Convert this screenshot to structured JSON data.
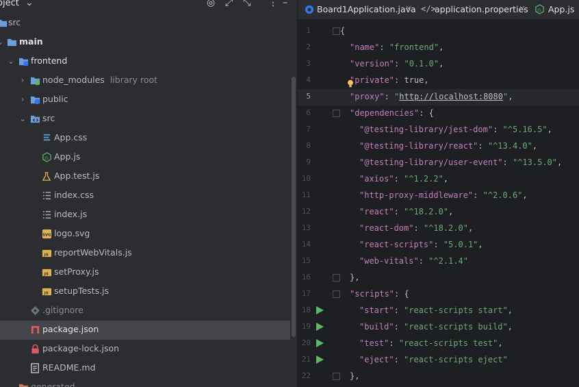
{
  "project_panel": {
    "title": "oject",
    "header_icons": [
      "chevron-down-icon",
      "locate-icon",
      "expand-all-icon",
      "collapse-all-icon",
      "more-options-icon",
      "hide-panel-icon"
    ],
    "tree": [
      {
        "label": "src",
        "icon": "folder-icon",
        "expanded": true
      },
      {
        "label": "main",
        "icon": "folder-icon",
        "expanded": true,
        "bold": true
      },
      {
        "label": "frontend",
        "icon": "module-folder-icon",
        "expanded": true
      },
      {
        "label": "node_modules",
        "suffix": "library root",
        "icon": "library-folder-icon",
        "expanded": false
      },
      {
        "label": "public",
        "icon": "web-folder-icon",
        "expanded": false
      },
      {
        "label": "src",
        "icon": "source-folder-icon",
        "expanded": true
      },
      {
        "label": "App.css",
        "icon": "css-file-icon"
      },
      {
        "label": "App.js",
        "icon": "nodejs-file-icon"
      },
      {
        "label": "App.test.js",
        "icon": "test-file-icon"
      },
      {
        "label": "index.css",
        "icon": "text-file-icon"
      },
      {
        "label": "index.js",
        "icon": "text-file-icon"
      },
      {
        "label": "logo.svg",
        "icon": "svg-file-icon"
      },
      {
        "label": "reportWebVitals.js",
        "icon": "js-file-icon"
      },
      {
        "label": "setProxy.js",
        "icon": "js-file-icon"
      },
      {
        "label": "setupTests.js",
        "icon": "js-file-icon"
      },
      {
        "label": ".gitignore",
        "icon": "gitignore-file-icon"
      },
      {
        "label": "package.json",
        "icon": "npm-file-icon",
        "selected": true
      },
      {
        "label": "package-lock.json",
        "icon": "lock-file-icon"
      },
      {
        "label": "README.md",
        "icon": "markdown-file-icon"
      },
      {
        "label": "generated",
        "icon": "folder-icon"
      }
    ]
  },
  "tabs": [
    {
      "label": "Board1Application.java",
      "icon": "java-file-icon",
      "close": "×"
    },
    {
      "label": "application.properties",
      "icon": "properties-file-icon",
      "close": "×"
    },
    {
      "label": "App.js",
      "icon": "nodejs-file-icon"
    }
  ],
  "editor": {
    "current_line": 5,
    "lines": [
      {
        "n": "1",
        "text": "{"
      },
      {
        "n": "2",
        "text": "\"name\": \"frontend\","
      },
      {
        "n": "3",
        "text": "\"version\": \"0.1.0\","
      },
      {
        "n": "4",
        "text": "\"private\": true,"
      },
      {
        "n": "5",
        "text": "\"proxy\": \"http://localhost:8080\","
      },
      {
        "n": "6",
        "text": "\"dependencies\": {"
      },
      {
        "n": "7",
        "text": "\"@testing-library/jest-dom\": \"^5.16.5\","
      },
      {
        "n": "8",
        "text": "\"@testing-library/react\": \"^13.4.0\","
      },
      {
        "n": "9",
        "text": "\"@testing-library/user-event\": \"^13.5.0\","
      },
      {
        "n": "10",
        "text": "\"axios\": \"^1.2.2\","
      },
      {
        "n": "11",
        "text": "\"http-proxy-middleware\": \"^2.0.6\","
      },
      {
        "n": "12",
        "text": "\"react\": \"^18.2.0\","
      },
      {
        "n": "13",
        "text": "\"react-dom\": \"^18.2.0\","
      },
      {
        "n": "14",
        "text": "\"react-scripts\": \"5.0.1\","
      },
      {
        "n": "15",
        "text": "\"web-vitals\": \"^2.1.4\""
      },
      {
        "n": "16",
        "text": "},"
      },
      {
        "n": "17",
        "text": "\"scripts\": {"
      },
      {
        "n": "18",
        "text": "\"start\": \"react-scripts start\","
      },
      {
        "n": "19",
        "text": "\"build\": \"react-scripts build\","
      },
      {
        "n": "20",
        "text": "\"test\": \"react-scripts test\","
      },
      {
        "n": "21",
        "text": "\"eject\": \"react-scripts eject\""
      },
      {
        "n": "22",
        "text": "},"
      }
    ]
  },
  "colors": {
    "key": "#c77dbb",
    "string": "#6aab73",
    "keyword": "#cf8e6d",
    "run": "#5fb865"
  }
}
